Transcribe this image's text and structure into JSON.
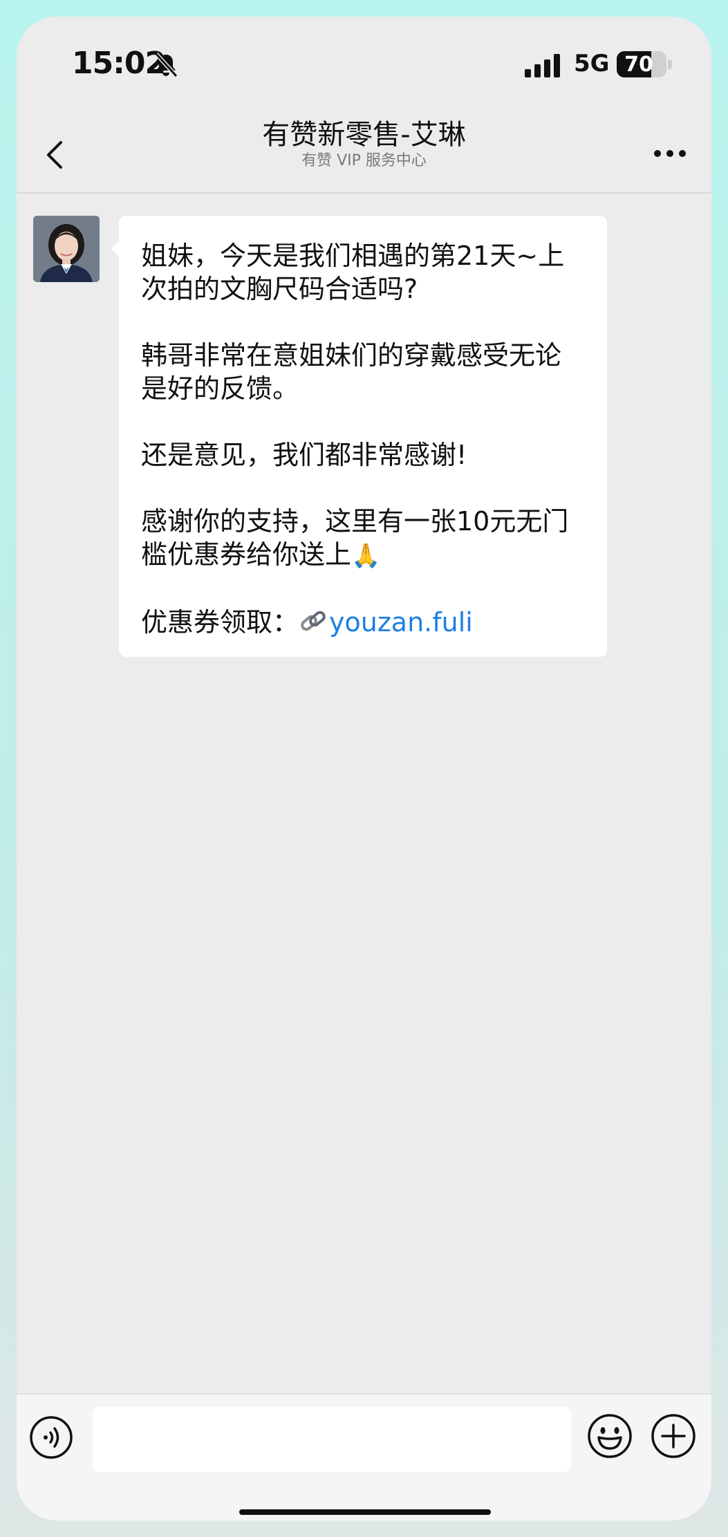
{
  "status_bar": {
    "time": "15:02",
    "network": "5G",
    "battery": "70",
    "battery_level": 0.7,
    "icons": [
      "bell-mute-icon",
      "signal-icon",
      "battery-icon"
    ]
  },
  "nav": {
    "title": "有赞新零售-艾琳",
    "subtitle": "有赞 VIP 服务中心",
    "back_icon": "chevron-left-icon",
    "more_icon": "ellipsis-icon"
  },
  "message": {
    "sender_avatar": "avatar",
    "paragraphs": [
      "姐妹，今天是我们相遇的第21天~上次拍的文胸尺码合适吗?",
      "韩哥非常在意姐妹们的穿戴感受无论是好的反馈。",
      "还是意见，我们都非常感谢!",
      "感谢你的支持，这里有一张10元无门槛优惠券给你送上"
    ],
    "pray_emoji": "🙏",
    "coupon_label": "优惠券领取：",
    "coupon_link_text": "youzan.fuli",
    "link_color": "#1e7fe0"
  },
  "input_bar": {
    "input_value": "",
    "icons": [
      "voice-icon",
      "emoji-icon",
      "plus-icon"
    ]
  }
}
